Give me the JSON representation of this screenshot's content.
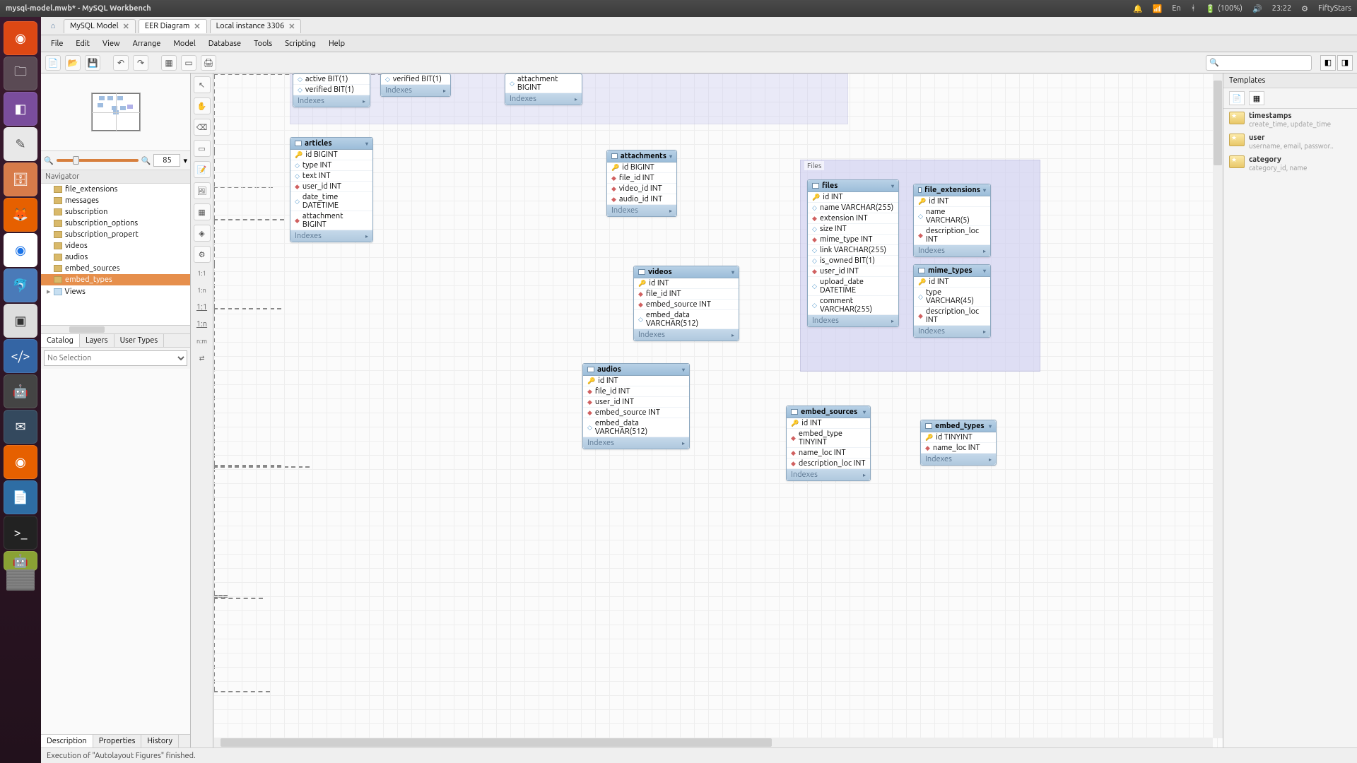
{
  "os": {
    "title": "mysql-model.mwb* - MySQL Workbench",
    "lang": "En",
    "battery": "(100%)",
    "time": "23:22",
    "user": "FiftyStars"
  },
  "tabs": {
    "t0": "MySQL Model",
    "t1": "EER Diagram",
    "t2": "Local instance 3306"
  },
  "menus": [
    "File",
    "Edit",
    "View",
    "Arrange",
    "Model",
    "Database",
    "Tools",
    "Scripting",
    "Help"
  ],
  "zoom": "85",
  "navigator_label": "Navigator",
  "tree": {
    "items": [
      "file_extensions",
      "messages",
      "subscription",
      "subscription_options",
      "subscription_propert",
      "videos",
      "audios",
      "embed_sources",
      "embed_types"
    ],
    "views": "Views"
  },
  "side_tabs": [
    "Catalog",
    "Layers",
    "User Types"
  ],
  "selection": "No Selection",
  "bottom_tabs": [
    "Description",
    "Properties",
    "History"
  ],
  "templates": {
    "header": "Templates",
    "items": [
      {
        "name": "timestamps",
        "desc": "create_time, update_time"
      },
      {
        "name": "user",
        "desc": "username, email, passwor.."
      },
      {
        "name": "category",
        "desc": "category_id, name"
      }
    ]
  },
  "status": "Execution of \"Autolayout Figures\" finished.",
  "layer_titles": {
    "files": "Files"
  },
  "idx_label": "Indexes",
  "entities": {
    "partial1": {
      "cols": [
        "active BIT(1)",
        "verified BIT(1)"
      ]
    },
    "partial2": {
      "cols": [
        "verified BIT(1)"
      ]
    },
    "partial3": {
      "cols": [
        "attachment BIGINT"
      ]
    },
    "articles": {
      "name": "articles",
      "cols": [
        [
          "k",
          "id BIGINT"
        ],
        [
          "n",
          "type INT"
        ],
        [
          "n",
          "text INT"
        ],
        [
          "f",
          "user_id INT"
        ],
        [
          "n",
          "date_time DATETIME"
        ],
        [
          "f",
          "attachment BIGINT"
        ]
      ]
    },
    "attachments": {
      "name": "attachments",
      "cols": [
        [
          "k",
          "id BIGINT"
        ],
        [
          "f",
          "file_id INT"
        ],
        [
          "f",
          "video_id INT"
        ],
        [
          "f",
          "audio_id INT"
        ]
      ]
    },
    "videos": {
      "name": "videos",
      "cols": [
        [
          "k",
          "id INT"
        ],
        [
          "f",
          "file_id INT"
        ],
        [
          "f",
          "embed_source INT"
        ],
        [
          "n",
          "embed_data VARCHAR(512)"
        ]
      ]
    },
    "audios": {
      "name": "audios",
      "cols": [
        [
          "k",
          "id INT"
        ],
        [
          "f",
          "file_id INT"
        ],
        [
          "f",
          "user_id INT"
        ],
        [
          "f",
          "embed_source INT"
        ],
        [
          "n",
          "embed_data VARCHAR(512)"
        ]
      ]
    },
    "files": {
      "name": "files",
      "cols": [
        [
          "k",
          "id INT"
        ],
        [
          "n",
          "name VARCHAR(255)"
        ],
        [
          "f",
          "extension INT"
        ],
        [
          "n",
          "size INT"
        ],
        [
          "f",
          "mime_type INT"
        ],
        [
          "n",
          "link VARCHAR(255)"
        ],
        [
          "n",
          "is_owned BIT(1)"
        ],
        [
          "f",
          "user_id INT"
        ],
        [
          "n",
          "upload_date DATETIME"
        ],
        [
          "n",
          "comment VARCHAR(255)"
        ]
      ]
    },
    "file_extensions": {
      "name": "file_extensions",
      "cols": [
        [
          "k",
          "id INT"
        ],
        [
          "n",
          "name VARCHAR(5)"
        ],
        [
          "f",
          "description_loc INT"
        ]
      ]
    },
    "mime_types": {
      "name": "mime_types",
      "cols": [
        [
          "k",
          "id INT"
        ],
        [
          "n",
          "type VARCHAR(45)"
        ],
        [
          "f",
          "description_loc INT"
        ]
      ]
    },
    "embed_sources": {
      "name": "embed_sources",
      "cols": [
        [
          "k",
          "id INT"
        ],
        [
          "f",
          "embed_type TINYINT"
        ],
        [
          "f",
          "name_loc INT"
        ],
        [
          "f",
          "description_loc INT"
        ]
      ]
    },
    "embed_types": {
      "name": "embed_types",
      "cols": [
        [
          "k",
          "id TINYINT"
        ],
        [
          "f",
          "name_loc INT"
        ]
      ]
    }
  }
}
